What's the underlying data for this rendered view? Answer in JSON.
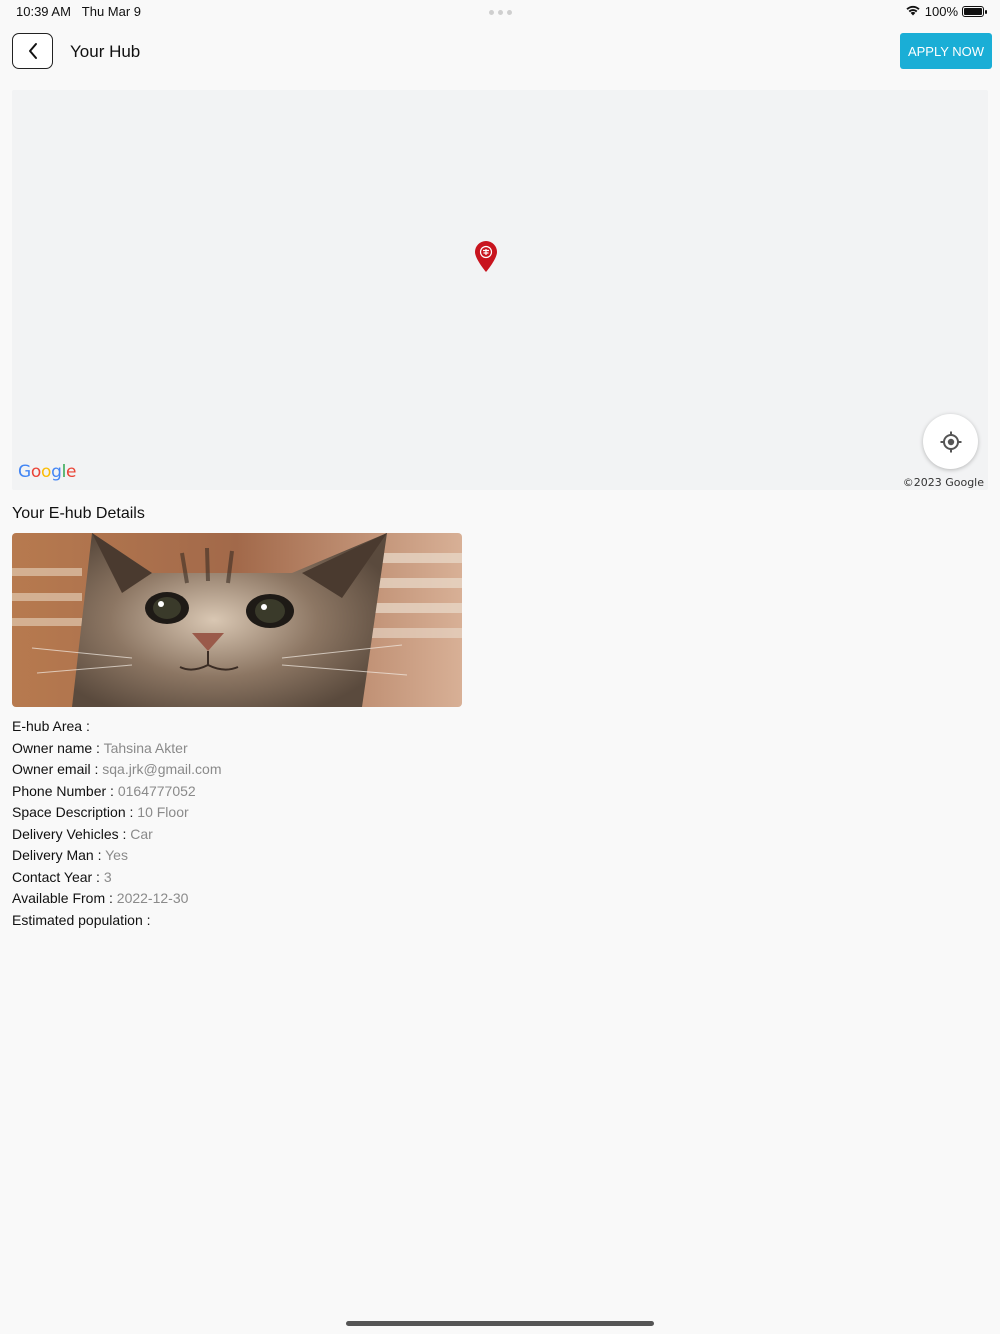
{
  "status": {
    "time": "10:39 AM",
    "date": "Thu Mar 9",
    "battery": "100%"
  },
  "header": {
    "title": "Your Hub",
    "apply_label": "APPLY NOW"
  },
  "map": {
    "logo_text": "Google",
    "copyright": "©2023 Google"
  },
  "section_title": "Your E-hub Details",
  "details": [
    {
      "label": "E-hub Area : ",
      "value": ""
    },
    {
      "label": "Owner name : ",
      "value": "Tahsina Akter"
    },
    {
      "label": "Owner email : ",
      "value": "sqa.jrk@gmail.com"
    },
    {
      "label": "Phone Number : ",
      "value": "0164777052"
    },
    {
      "label": "Space Description : ",
      "value": "10 Floor"
    },
    {
      "label": "Delivery Vehicles : ",
      "value": "Car"
    },
    {
      "label": "Delivery Man : ",
      "value": "Yes"
    },
    {
      "label": "Contact Year : ",
      "value": "3"
    },
    {
      "label": "Available From : ",
      "value": "2022-12-30"
    },
    {
      "label": "Estimated population : ",
      "value": ""
    }
  ],
  "colors": {
    "accent": "#1aaed6",
    "pin": "#c8141e",
    "value_text": "#8a8a8a"
  }
}
